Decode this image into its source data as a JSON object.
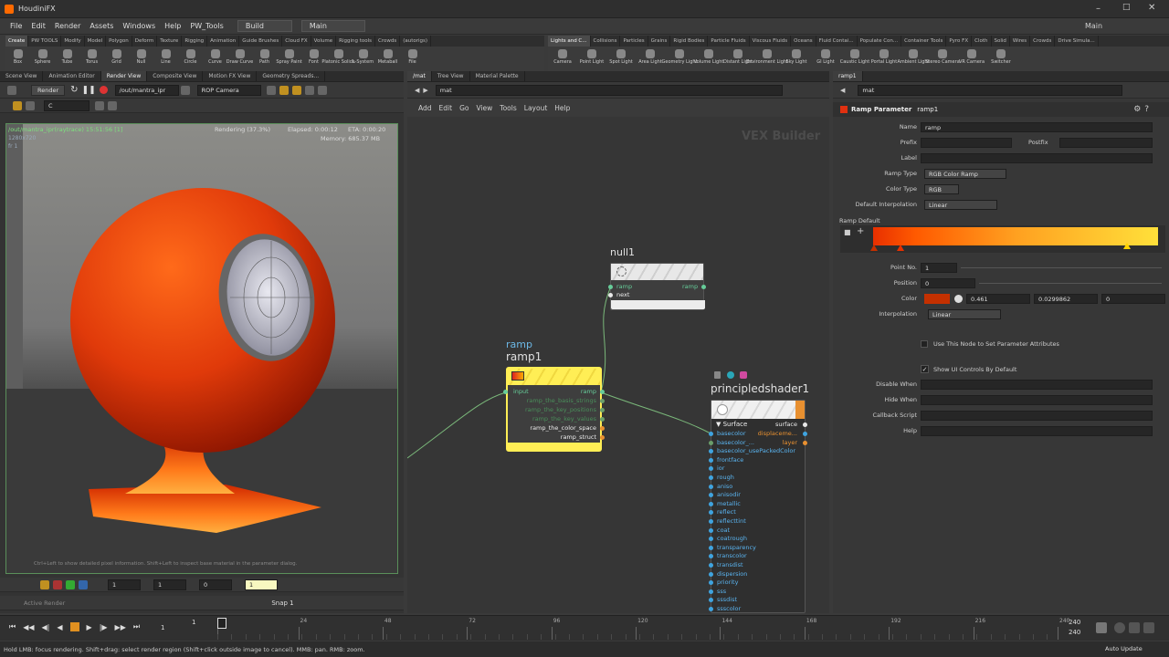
{
  "app": {
    "title": "HoudiniFX",
    "desk": "Build",
    "desktop": "Main",
    "right_desktop": "Main"
  },
  "menu": [
    "File",
    "Edit",
    "Render",
    "Assets",
    "Windows",
    "Help",
    "PW_Tools"
  ],
  "shelf_left": {
    "tabs": [
      "Create",
      "PW TOOLS",
      "Modify",
      "Model",
      "Polygon",
      "Deform",
      "Texture",
      "Rigging",
      "Animation",
      "Guide Brushes",
      "Cloud FX",
      "Volume",
      "Rigging tools",
      "Crowds",
      "(autorigs)"
    ],
    "tools": [
      "Box",
      "Sphere",
      "Tube",
      "Torus",
      "Grid",
      "Null",
      "Line",
      "Circle",
      "Curve",
      "Draw Curve",
      "Path",
      "Spray Paint",
      "Font",
      "Platonic Solids",
      "L-System",
      "Metaball",
      "File"
    ]
  },
  "shelf_right": {
    "tabs": [
      "Lights and C...",
      "Collisions",
      "Particles",
      "Grains",
      "Rigid Bodies",
      "Particle Fluids",
      "Viscous Fluids",
      "Oceans",
      "Fluid Contai...",
      "Populate Con...",
      "Container Tools",
      "Pyro FX",
      "Cloth",
      "Solid",
      "Wires",
      "Crowds",
      "Drive Simula..."
    ],
    "tools": [
      "Camera",
      "Point Light",
      "Spot Light",
      "Area Light",
      "Geometry Light",
      "Volume Light",
      "Distant Light",
      "Environment Light",
      "Sky Light",
      "GI Light",
      "Caustic Light",
      "Portal Light",
      "Ambient Light",
      "Stereo Camera",
      "VR Camera",
      "Switcher"
    ]
  },
  "left_pane": {
    "tabs": [
      "Scene View",
      "Animation Editor",
      "Render View",
      "Composite View",
      "Motion FX View",
      "Geometry Spreads..."
    ],
    "render_btn": "Render",
    "rop_path": "/out/mantra_ipr",
    "camera": "ROP Camera",
    "channel": "C",
    "status": "Rendering (37.3%)",
    "elapsed": "Elapsed: 0:00:12",
    "eta": "ETA: 0:00:20",
    "memory": "Memory: 685.37 MB",
    "image_name": "/out/mantra_ipr(raytrace) 15:51:56 [1]",
    "resolution": "1280x720",
    "frame_info": "fr 1",
    "hint": "Ctrl+Left to show detailed pixel information. Shift+Left to inspect base material in the parameter dialog.",
    "bottom_values": [
      "1",
      "1",
      "0",
      "1"
    ],
    "snap": "Snap 1",
    "active_render": "Active Render"
  },
  "mid_pane": {
    "tabs": [
      "/mat",
      "Tree View",
      "Material Palette"
    ],
    "path": "mat",
    "menu": [
      "Add",
      "Edit",
      "Go",
      "View",
      "Tools",
      "Layout",
      "Help"
    ],
    "context_label": "VEX Builder",
    "nodes": {
      "null": {
        "name": "null1",
        "in_ports": [
          "ramp",
          "next"
        ],
        "out_port": "ramp"
      },
      "ramp": {
        "type_label": "ramp",
        "name": "ramp1",
        "in_port": "input",
        "out_ports": [
          "ramp",
          "ramp_the_basis_strings",
          "ramp_the_key_positions",
          "ramp_the_key_values",
          "ramp_the_color_space",
          "ramp_struct"
        ]
      },
      "principled": {
        "name": "principledshader1",
        "section": "Surface",
        "out_ports": [
          "surface",
          "displaceme...",
          "layer"
        ],
        "in_ports": [
          "basecolor",
          "basecolor_...",
          "basecolor_usePackedColor",
          "frontface",
          "ior",
          "rough",
          "aniso",
          "anisodir",
          "metallic",
          "reflect",
          "reflecttint",
          "coat",
          "coatrough",
          "transparency",
          "transcolor",
          "transdist",
          "dispersion",
          "priority",
          "sss",
          "sssdist",
          "ssscolor"
        ]
      }
    }
  },
  "right_pane": {
    "tabs": [
      "ramp1"
    ],
    "path": "mat",
    "header_label": "Ramp Parameter",
    "header_node": "ramp1",
    "name_label": "Name",
    "name_value": "ramp",
    "prefix_label": "Prefix",
    "postfix_label": "Postfix",
    "label_label": "Label",
    "ramp_type_label": "Ramp Type",
    "ramp_type_value": "RGB Color Ramp",
    "color_type_label": "Color Type",
    "color_type_value": "RGB",
    "default_interp_label": "Default Interpolation",
    "default_interp_value": "Linear",
    "ramp_default_label": "Ramp Default",
    "point_no_label": "Point No.",
    "point_no_value": "1",
    "position_label": "Position",
    "position_value": "0",
    "color_label": "Color",
    "color_values": [
      "0.461",
      "0.0299862",
      "0"
    ],
    "interp_label": "Interpolation",
    "interp_value": "Linear",
    "use_node_label": "Use This Node to Set Parameter Attributes",
    "show_ui_label": "Show UI Controls By Default",
    "disable_when": "Disable When",
    "hide_when": "Hide When",
    "callback_script": "Callback Script",
    "help": "Help"
  },
  "timeline": {
    "start": "1",
    "current": "1",
    "ticks": [
      "1",
      "24",
      "48",
      "72",
      "96",
      "120",
      "144",
      "168",
      "192",
      "216",
      "240"
    ],
    "end_values": [
      "240",
      "240"
    ]
  },
  "statusbar": {
    "text": "Hold LMB: focus rendering. Shift+drag: select render region (Shift+click outside image to cancel). MMB: pan. RMB: zoom.",
    "auto_update": "Auto Update"
  },
  "colors": {
    "accent": "#f5c400",
    "node_yellow": "#ffee55",
    "ramp_red": "#e83000",
    "ramp_yellow": "#ffe03a",
    "port_green": "#66cc99",
    "port_blue": "#3fa4e0",
    "port_orange": "#e89030",
    "wire": "#7ab87a"
  }
}
